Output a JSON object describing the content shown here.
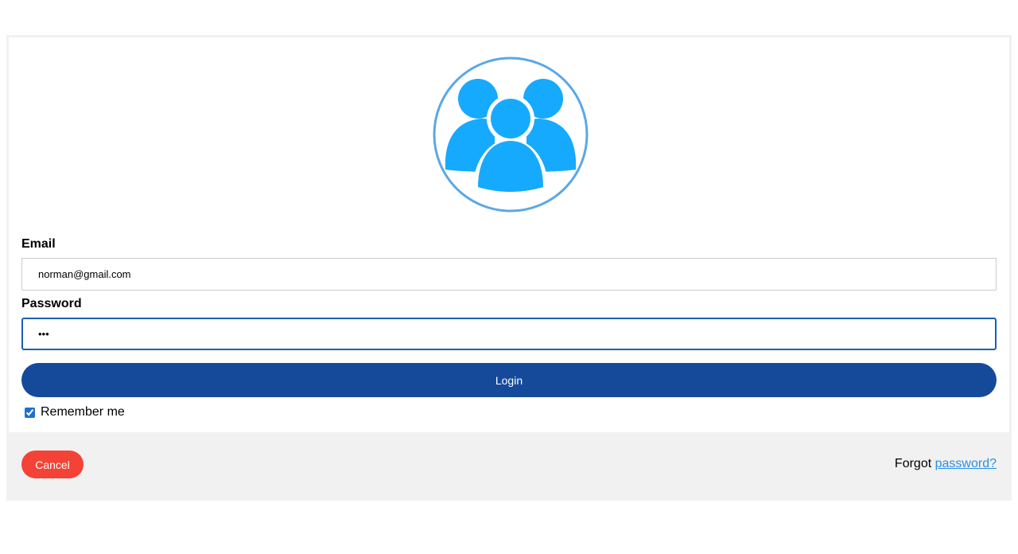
{
  "avatar": {
    "icon": "users-group-icon",
    "colors": {
      "ring": "#5aa8e8",
      "figures": "#16aaff"
    }
  },
  "form": {
    "email_label": "Email",
    "email_value": "norman@gmail.com",
    "password_label": "Password",
    "password_value": "abc",
    "login_label": "Login",
    "remember_label": "Remember me",
    "remember_checked": true
  },
  "footer": {
    "cancel_label": "Cancel",
    "forgot_prefix": "Forgot",
    "forgot_link": "password?"
  },
  "colors": {
    "login_button": "#154a9b",
    "cancel_button": "#f44336",
    "link": "#2b8fe8",
    "footer_bg": "#f1f1f1"
  }
}
